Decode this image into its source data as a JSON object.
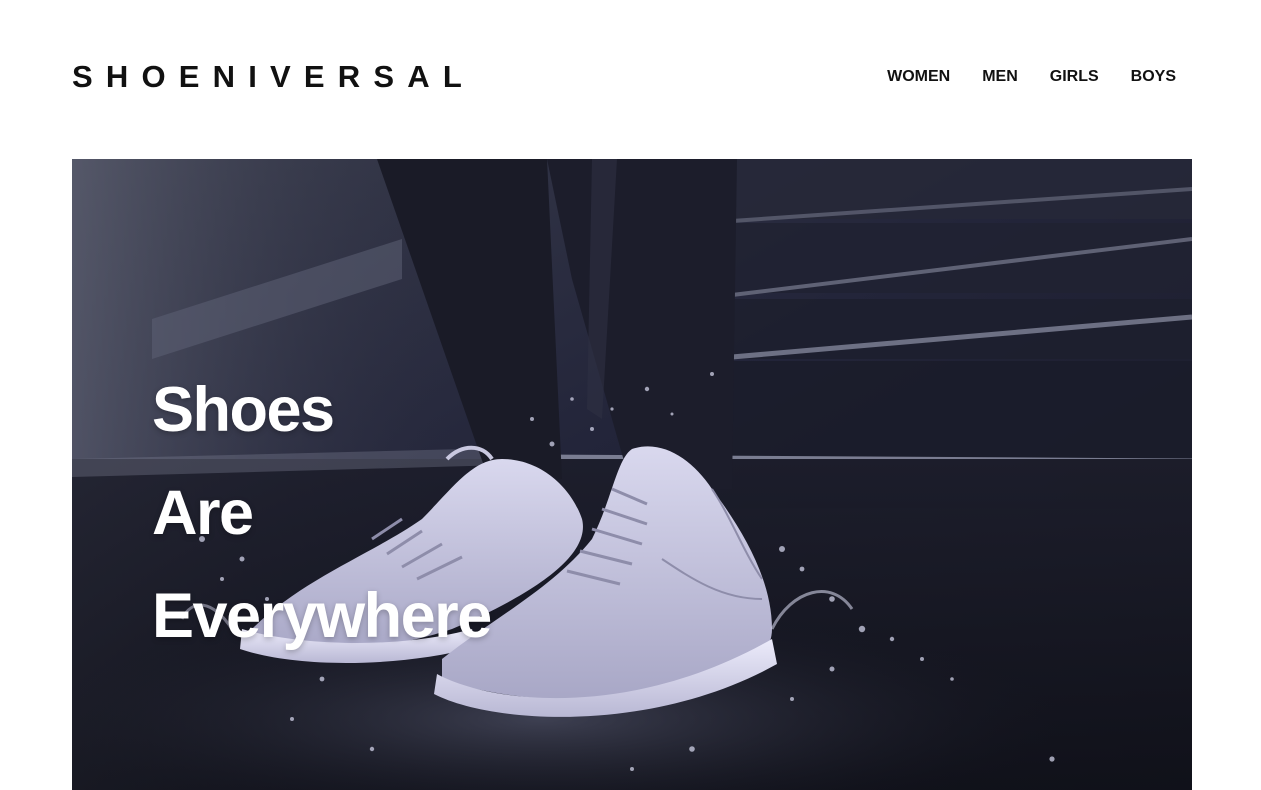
{
  "header": {
    "logo": "SHOENIVERSAL",
    "nav": [
      {
        "label": "WOMEN"
      },
      {
        "label": "MEN"
      },
      {
        "label": "GIRLS"
      },
      {
        "label": "BOYS"
      }
    ]
  },
  "hero": {
    "title_lines": [
      "Shoes",
      "Are",
      "Everywhere"
    ],
    "image_description": "sneakers-splashing-water-photo"
  },
  "colors": {
    "text_dark": "#111111",
    "hero_bg": "#20212e",
    "hero_text": "#ffffff"
  }
}
